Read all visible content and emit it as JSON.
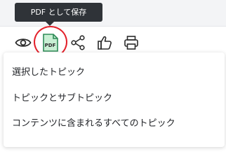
{
  "tooltip": {
    "text": "PDF として保存"
  },
  "toolbar": {
    "view_icon": "eye-icon",
    "pdf_icon": "pdf-document-icon",
    "pdf_badge": "PDF",
    "share_icon": "share-icon",
    "like_icon": "thumbs-up-icon",
    "print_icon": "printer-icon",
    "highlight_color": "#e3202a",
    "pdf_icon_color": "#2e8b57"
  },
  "menu": {
    "items": [
      {
        "label": "選択したトピック"
      },
      {
        "label": "トピックとサブトピック"
      },
      {
        "label": "コンテンツに含まれるすべてのトピック"
      }
    ]
  }
}
